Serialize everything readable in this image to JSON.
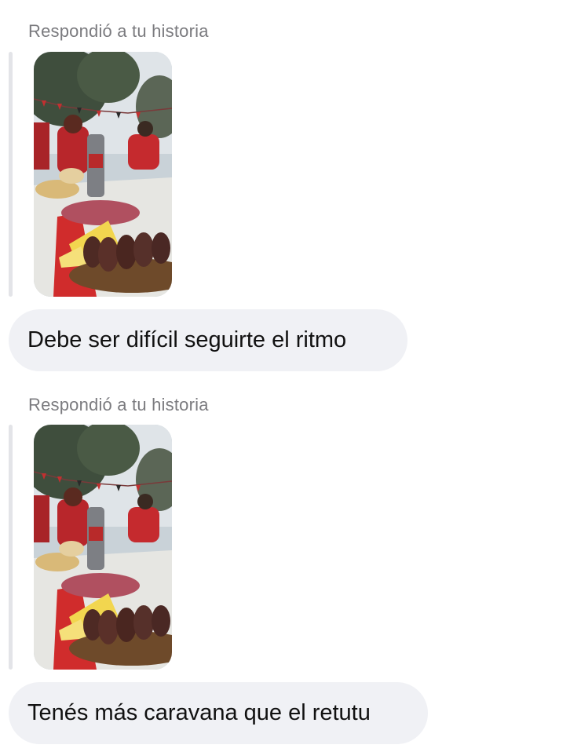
{
  "messages": [
    {
      "reply_label": "Respondió a tu historia",
      "story_thumbnail": "story-photo-outdoor-picada",
      "text": "Debe ser difícil seguirte el ritmo"
    },
    {
      "reply_label": "Respondió a tu historia",
      "story_thumbnail": "story-photo-outdoor-picada",
      "text": "Tenés más caravana que el retutu"
    }
  ],
  "colors": {
    "bubble_bg": "#f0f1f5",
    "label_text": "#7b7b7f",
    "story_bar": "#e3e4e8",
    "message_text": "#111111"
  }
}
